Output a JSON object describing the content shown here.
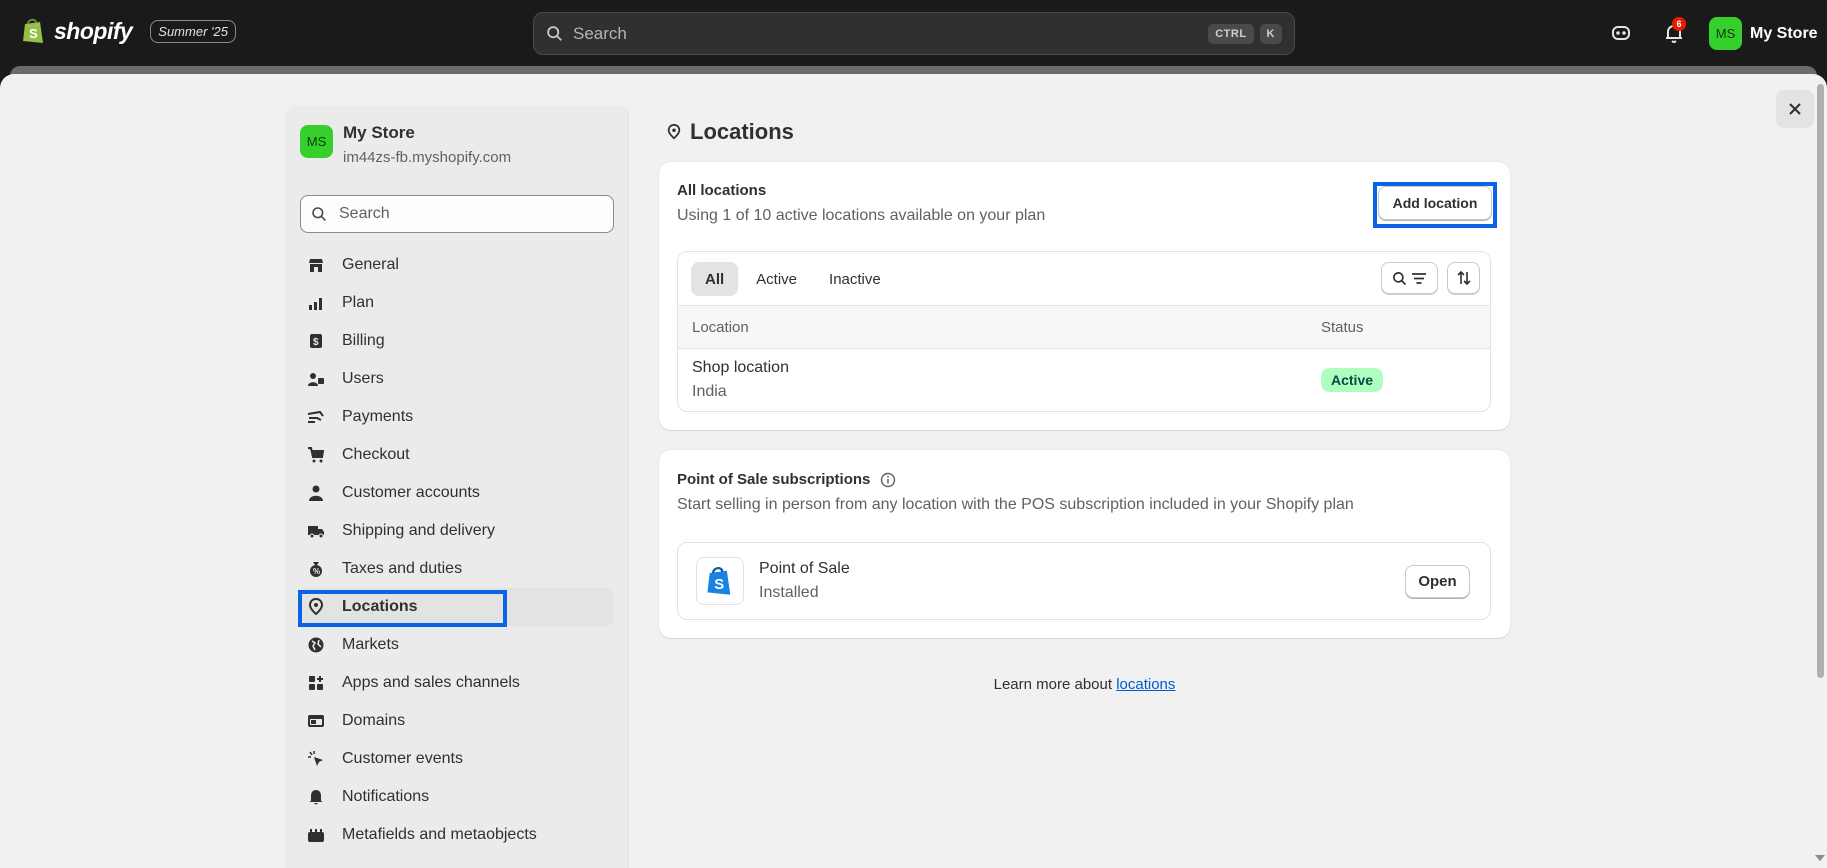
{
  "topbar": {
    "brand": "shopify",
    "edition": "Summer '25",
    "search_placeholder": "Search",
    "shortcut_keys": [
      "CTRL",
      "K"
    ],
    "notification_count": "6",
    "user_initials": "MS",
    "user_name": "My Store"
  },
  "store": {
    "initials": "MS",
    "name": "My Store",
    "url": "im44zs-fb.myshopify.com"
  },
  "sidebar": {
    "search_placeholder": "Search",
    "items": [
      {
        "label": "General",
        "icon": "store-icon"
      },
      {
        "label": "Plan",
        "icon": "plan-icon"
      },
      {
        "label": "Billing",
        "icon": "receipt-icon"
      },
      {
        "label": "Users",
        "icon": "users-icon"
      },
      {
        "label": "Payments",
        "icon": "payments-icon"
      },
      {
        "label": "Checkout",
        "icon": "cart-icon"
      },
      {
        "label": "Customer accounts",
        "icon": "person-icon"
      },
      {
        "label": "Shipping and delivery",
        "icon": "truck-icon"
      },
      {
        "label": "Taxes and duties",
        "icon": "tax-bag-icon"
      },
      {
        "label": "Locations",
        "icon": "location-pin-icon",
        "active": true
      },
      {
        "label": "Markets",
        "icon": "globe-icon"
      },
      {
        "label": "Apps and sales channels",
        "icon": "apps-icon"
      },
      {
        "label": "Domains",
        "icon": "domain-icon"
      },
      {
        "label": "Customer events",
        "icon": "cursor-click-icon"
      },
      {
        "label": "Notifications",
        "icon": "bell-icon"
      },
      {
        "label": "Metafields and metaobjects",
        "icon": "metafields-icon"
      }
    ]
  },
  "page": {
    "title": "Locations"
  },
  "all_locations": {
    "heading": "All locations",
    "subtitle": "Using 1 of 10 active locations available on your plan",
    "add_button": "Add location",
    "tabs": [
      "All",
      "Active",
      "Inactive"
    ],
    "selected_tab": "All",
    "columns": [
      "Location",
      "Status"
    ],
    "rows": [
      {
        "name": "Shop location",
        "country": "India",
        "status": "Active"
      }
    ]
  },
  "pos": {
    "heading": "Point of Sale subscriptions",
    "subtitle": "Start selling in person from any location with the POS subscription included in your Shopify plan",
    "app_name": "Point of Sale",
    "app_status": "Installed",
    "open_button": "Open"
  },
  "footer": {
    "learn_prefix": "Learn more about ",
    "learn_link": "locations"
  },
  "colors": {
    "accent_highlight": "#0b63e5",
    "avatar_green": "#36d02d",
    "active_badge_bg": "#affebf",
    "link": "#005bd3"
  }
}
